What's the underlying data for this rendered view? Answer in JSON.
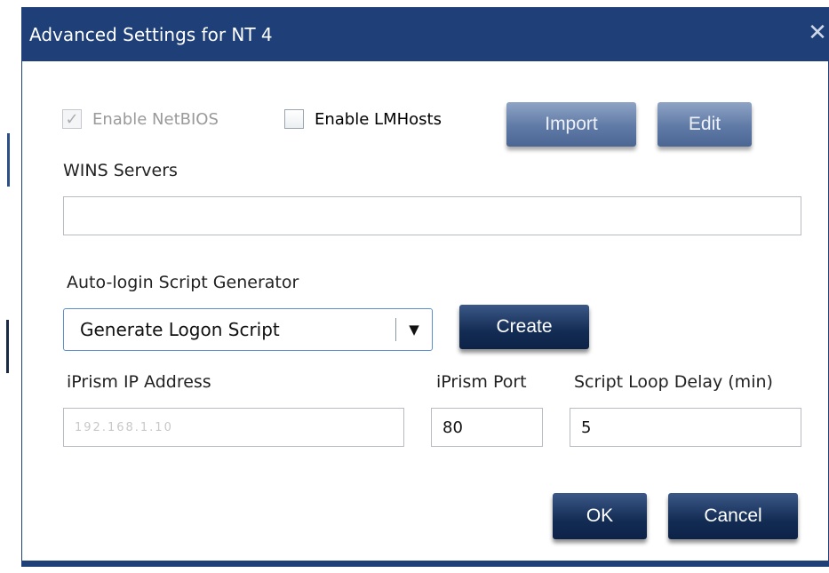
{
  "window": {
    "title": "Advanced Settings for NT 4",
    "close_glyph": "✕"
  },
  "netbios": {
    "enable_netbios_label": "Enable NetBIOS",
    "enable_netbios_checked": true,
    "enable_lmhosts_label": "Enable LMHosts",
    "enable_lmhosts_checked": false,
    "import_label": "Import",
    "edit_label": "Edit"
  },
  "wins": {
    "label": "WINS Servers",
    "value": ""
  },
  "autologin": {
    "section_label": "Auto-login Script Generator",
    "selected_option": "Generate Logon Script",
    "create_label": "Create"
  },
  "fields": {
    "ip_label": "iPrism IP Address",
    "ip_value": "192.168.1.10",
    "port_label": "iPrism Port",
    "port_value": "80",
    "delay_label": "Script Loop Delay (min)",
    "delay_value": "5"
  },
  "actions": {
    "ok_label": "OK",
    "cancel_label": "Cancel"
  },
  "colors": {
    "titlebar": "#1f3f78",
    "button_dark": "#132c54",
    "button_disabled": "#5f7aa6"
  }
}
